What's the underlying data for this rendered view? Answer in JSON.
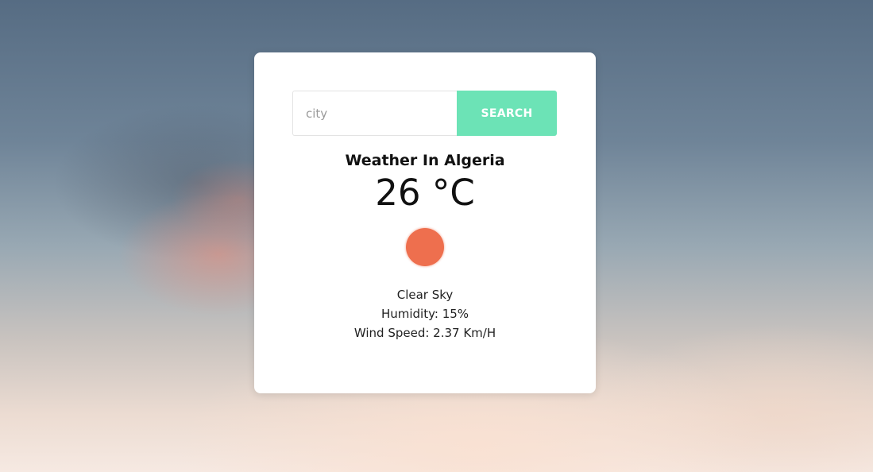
{
  "search": {
    "placeholder": "city",
    "value": "",
    "button_label": "SEARCH"
  },
  "weather": {
    "title": "Weather In Algeria",
    "temperature": "26 °C",
    "icon": "sun-icon",
    "description": "Clear Sky",
    "humidity": "Humidity: 15%",
    "wind_speed": "Wind Speed: 2.37 Km/H"
  },
  "colors": {
    "accent": "#6ce3b6",
    "sun": "#ee6f4e",
    "card": "#ffffff"
  }
}
